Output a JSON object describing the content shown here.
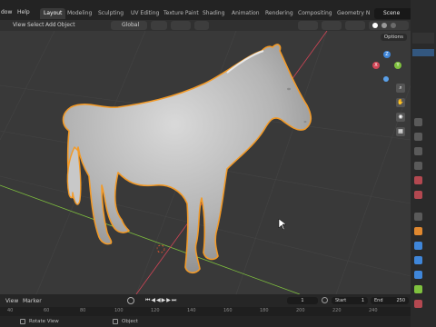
{
  "topbar": {
    "menus": [
      "dow",
      "Help"
    ],
    "workspaces": [
      "Layout",
      "Modeling",
      "Sculpting",
      "UV Editing",
      "Texture Paint",
      "Shading",
      "Animation",
      "Rendering",
      "Compositing",
      "Geometry N"
    ],
    "active_workspace": "Layout",
    "scene": "Scene"
  },
  "viewport_header": {
    "menus": [
      "View",
      "Select",
      "Add",
      "Object"
    ],
    "orientation": "Global"
  },
  "viewport": {
    "options_label": "Options",
    "gizmo": {
      "x": "X",
      "y": "Y",
      "z": "Z"
    }
  },
  "timeline": {
    "menus": [
      "View",
      "Marker"
    ],
    "current_frame": "1",
    "start_label": "Start",
    "start": "1",
    "end_label": "End",
    "end": "250",
    "ruler": [
      "40",
      "60",
      "80",
      "100",
      "120",
      "140",
      "160",
      "180",
      "200",
      "220",
      "240"
    ]
  },
  "statusbar": {
    "left": "Rotate View",
    "center": "Object"
  },
  "colors": {
    "selection_outline": "#f29a28",
    "axis_x": "#d14556",
    "axis_y": "#7fc13e",
    "axis_z": "#3f86d9"
  }
}
